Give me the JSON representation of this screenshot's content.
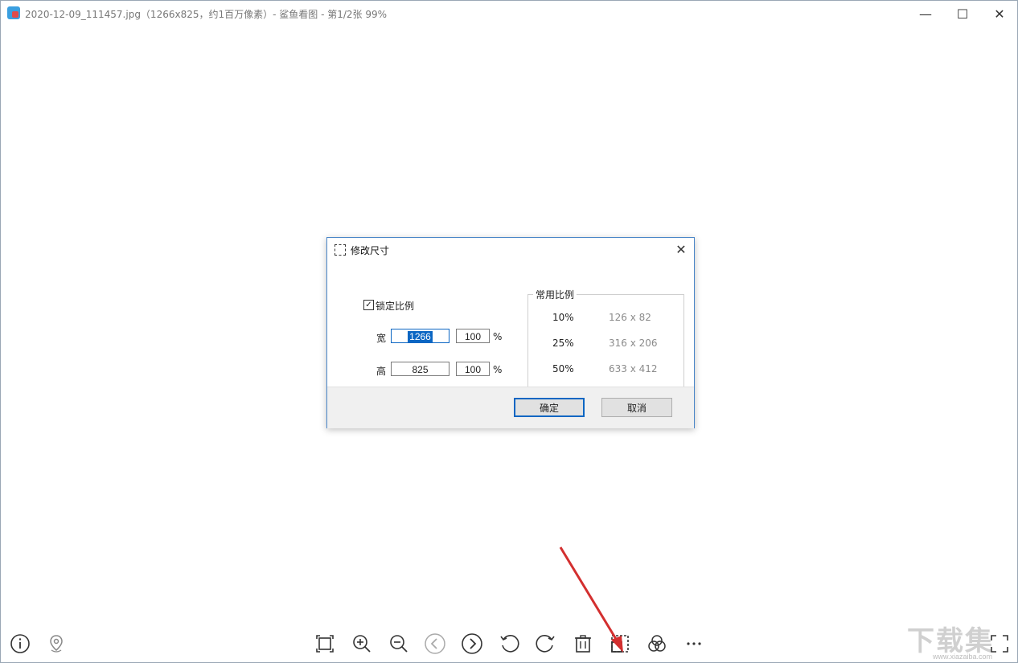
{
  "window": {
    "title": "2020-12-09_111457.jpg（1266x825，约1百万像素）- 鲨鱼看图 - 第1/2张 99%",
    "controls": {
      "minimize": "—",
      "maximize": "☐",
      "close": "✕"
    }
  },
  "dialog": {
    "title": "修改尺寸",
    "close": "✕",
    "lock_label": "锁定比例",
    "lock_checked": true,
    "width_label": "宽",
    "height_label": "高",
    "width_value": "1266",
    "width_percent": "100",
    "height_value": "825",
    "height_percent": "100",
    "percent_sign": "%",
    "presets_title": "常用比例",
    "presets": [
      {
        "pct": "10%",
        "dims": "126 x 82"
      },
      {
        "pct": "25%",
        "dims": "316 x 206"
      },
      {
        "pct": "50%",
        "dims": "633 x 412"
      }
    ],
    "ok_label": "确定",
    "cancel_label": "取消"
  },
  "toolbar": {
    "icons": [
      "info-icon",
      "location-icon",
      "fit-window-icon",
      "zoom-in-icon",
      "zoom-out-icon",
      "previous-icon",
      "next-icon",
      "rotate-left-icon",
      "rotate-right-icon",
      "delete-icon",
      "resize-icon",
      "filter-icon",
      "more-icon",
      "fullscreen-icon"
    ]
  },
  "watermark": {
    "text": "下载集",
    "url": "www.xiazaiba.com"
  },
  "colors": {
    "accent": "#0b66c3",
    "arrow": "#d32f2f"
  }
}
